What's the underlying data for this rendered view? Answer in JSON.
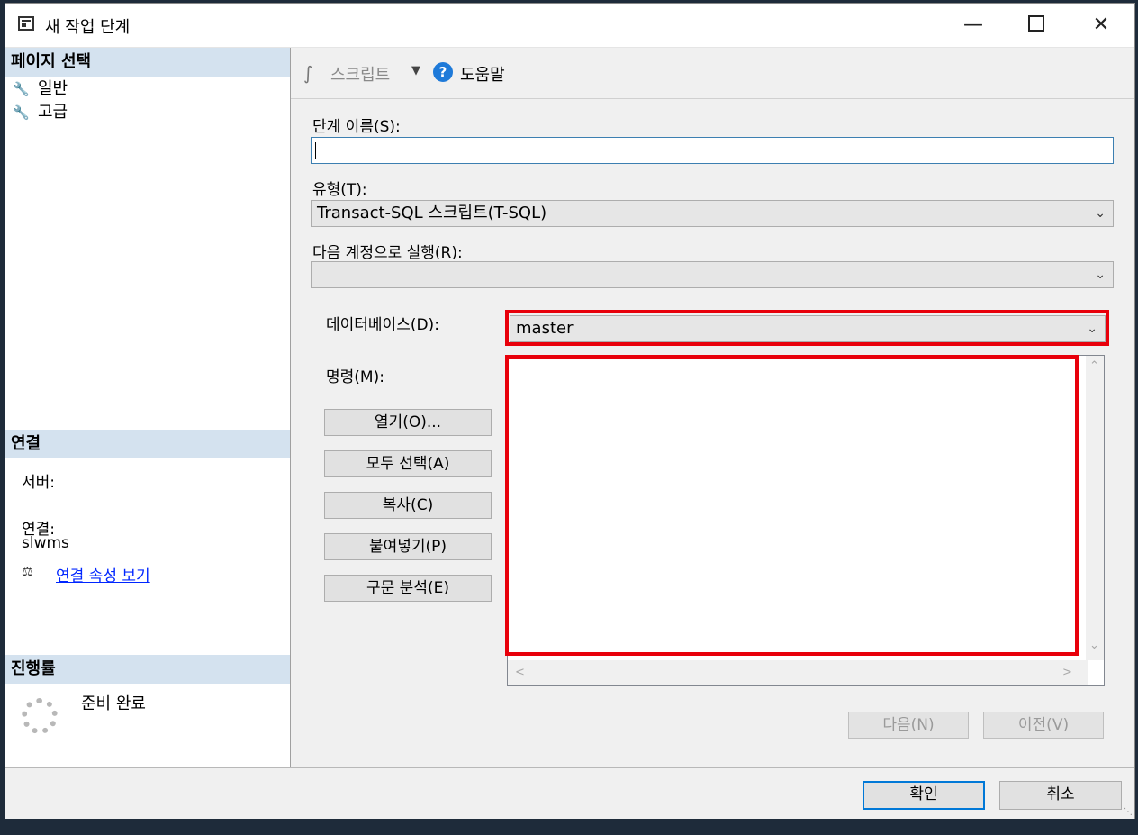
{
  "window": {
    "title": "새 작업 단계",
    "minimize": "—",
    "close": "✕"
  },
  "left": {
    "page_select_header": "페이지 선택",
    "nav_items": [
      {
        "label": "일반",
        "icon": "wrench-icon"
      },
      {
        "label": "고급",
        "icon": "wrench-icon"
      }
    ],
    "connection_header": "연결",
    "server_label": "서버:",
    "connection_label": "연결:",
    "connection_value": "slwms",
    "view_props_link": "연결 속성 보기",
    "progress_header": "진행률",
    "progress_status": "준비 완료"
  },
  "toolbar": {
    "script_label": "스크립트",
    "help_label": "도움말"
  },
  "form": {
    "step_name_label": "단계 이름(S):",
    "step_name_value": "",
    "type_label": "유형(T):",
    "type_value": "Transact-SQL 스크립트(T-SQL)",
    "run_as_label": "다음 계정으로 실행(R):",
    "run_as_value": "",
    "database_label": "데이터베이스(D):",
    "database_value": "master",
    "command_label": "명령(M):",
    "command_value": ""
  },
  "side_buttons": {
    "open": "열기(O)...",
    "select_all": "모두 선택(A)",
    "copy": "복사(C)",
    "paste": "붙여넣기(P)",
    "parse": "구문 분석(E)"
  },
  "nav_buttons": {
    "next": "다음(N)",
    "prev": "이전(V)"
  },
  "footer": {
    "ok": "확인",
    "cancel": "취소"
  },
  "colors": {
    "highlight": "#e8000b",
    "section_header": "#d4e2ef",
    "link": "#0026ff",
    "focus_border": "#0078d7"
  }
}
